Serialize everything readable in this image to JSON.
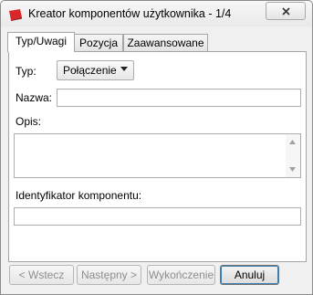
{
  "window": {
    "title": "Kreator komponentów użytkownika - 1/4",
    "icon": "app-icon",
    "close_icon": "close-icon"
  },
  "tabs": [
    {
      "label": "Typ/Uwagi",
      "active": true
    },
    {
      "label": "Pozycja",
      "active": false
    },
    {
      "label": "Zaawansowane",
      "active": false
    }
  ],
  "form": {
    "type_label": "Typ:",
    "type_value": "Połączenie",
    "name_label": "Nazwa:",
    "name_value": "",
    "description_label": "Opis:",
    "description_value": "",
    "component_id_label": "Identyfikator komponentu:",
    "component_id_value": ""
  },
  "buttons": {
    "back": "< Wstecz",
    "next": "Następny >",
    "finish": "Wykończenie",
    "cancel": "Anuluj"
  },
  "colors": {
    "accent": "#3c7fb1",
    "icon_red": "#d9262b",
    "disabled_text": "#8e8e8e"
  }
}
